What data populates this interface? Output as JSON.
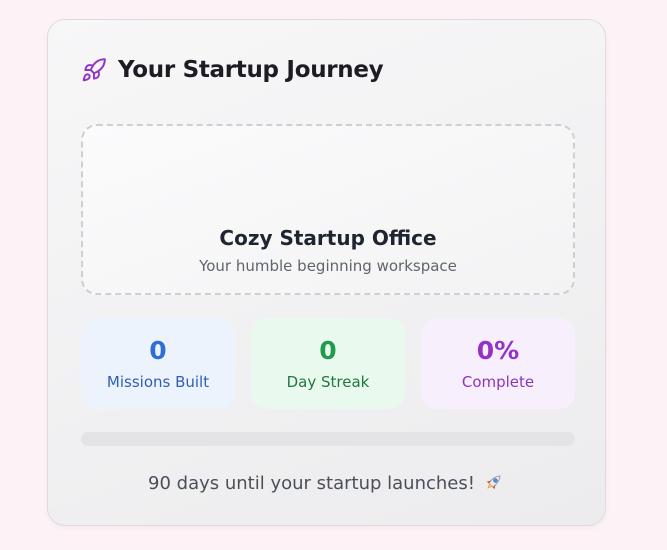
{
  "card": {
    "title": "Your Startup Journey",
    "title_icon": "rocket-icon",
    "accent": "#9333c8"
  },
  "office": {
    "title": "Cozy Startup Office",
    "subtitle": "Your humble beginning workspace"
  },
  "stats": [
    {
      "value": "0",
      "label": "Missions Built",
      "color": "#2f6ed6"
    },
    {
      "value": "0",
      "label": "Day Streak",
      "color": "#1f9c4b"
    },
    {
      "value": "0%",
      "label": "Complete",
      "color": "#9333c8"
    }
  ],
  "progress": {
    "fraction": 0
  },
  "footer": {
    "text": "90 days until your startup launches!",
    "icon": "rocket-emoji-icon"
  }
}
